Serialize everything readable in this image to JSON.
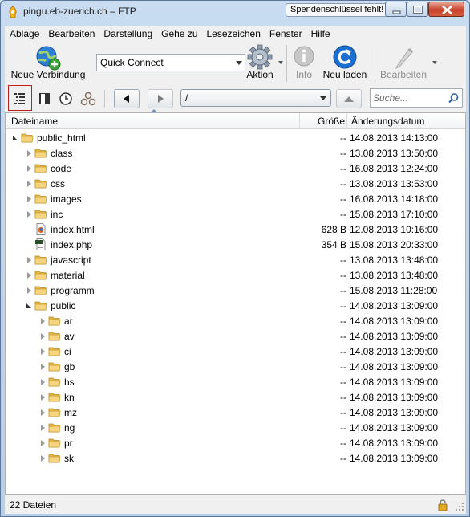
{
  "window": {
    "title": "pingu.eb-zuerich.ch – FTP",
    "donate_badge": "Spendenschlüssel fehlt!"
  },
  "menu": [
    "Ablage",
    "Bearbeiten",
    "Darstellung",
    "Gehe zu",
    "Lesezeichen",
    "Fenster",
    "Hilfe"
  ],
  "toolbar": {
    "new_connection": "Neue Verbindung",
    "quick_connect": "Quick Connect",
    "action": "Aktion",
    "info": "Info",
    "reload": "Neu laden",
    "edit": "Bearbeiten"
  },
  "navigation": {
    "path": "/",
    "search_placeholder": "Suche..."
  },
  "columns": {
    "name": "Dateiname",
    "size": "Größe",
    "date": "Änderungsdatum"
  },
  "files": [
    {
      "name": "public_html",
      "type": "folder",
      "level": 0,
      "expanded": true,
      "size": "--",
      "date": "14.08.2013 14:13:00"
    },
    {
      "name": "class",
      "type": "folder",
      "level": 1,
      "expanded": false,
      "size": "--",
      "date": "13.08.2013 13:50:00"
    },
    {
      "name": "code",
      "type": "folder",
      "level": 1,
      "expanded": false,
      "size": "--",
      "date": "16.08.2013 12:24:00"
    },
    {
      "name": "css",
      "type": "folder",
      "level": 1,
      "expanded": false,
      "size": "--",
      "date": "13.08.2013 13:53:00"
    },
    {
      "name": "images",
      "type": "folder",
      "level": 1,
      "expanded": false,
      "size": "--",
      "date": "16.08.2013 14:18:00"
    },
    {
      "name": "inc",
      "type": "folder",
      "level": 1,
      "expanded": false,
      "size": "--",
      "date": "15.08.2013 17:10:00"
    },
    {
      "name": "index.html",
      "type": "html",
      "level": 1,
      "size": "628 B",
      "date": "12.08.2013 10:16:00"
    },
    {
      "name": "index.php",
      "type": "php",
      "level": 1,
      "size": "354 B",
      "date": "15.08.2013 20:33:00"
    },
    {
      "name": "javascript",
      "type": "folder",
      "level": 1,
      "expanded": false,
      "size": "--",
      "date": "13.08.2013 13:48:00"
    },
    {
      "name": "material",
      "type": "folder",
      "level": 1,
      "expanded": false,
      "size": "--",
      "date": "13.08.2013 13:48:00"
    },
    {
      "name": "programm",
      "type": "folder",
      "level": 1,
      "expanded": false,
      "size": "--",
      "date": "15.08.2013 11:28:00"
    },
    {
      "name": "public",
      "type": "folder",
      "level": 1,
      "expanded": true,
      "size": "--",
      "date": "14.08.2013 13:09:00"
    },
    {
      "name": "ar",
      "type": "folder",
      "level": 2,
      "expanded": false,
      "size": "--",
      "date": "14.08.2013 13:09:00"
    },
    {
      "name": "av",
      "type": "folder",
      "level": 2,
      "expanded": false,
      "size": "--",
      "date": "14.08.2013 13:09:00"
    },
    {
      "name": "ci",
      "type": "folder",
      "level": 2,
      "expanded": false,
      "size": "--",
      "date": "14.08.2013 13:09:00"
    },
    {
      "name": "gb",
      "type": "folder",
      "level": 2,
      "expanded": false,
      "size": "--",
      "date": "14.08.2013 13:09:00"
    },
    {
      "name": "hs",
      "type": "folder",
      "level": 2,
      "expanded": false,
      "size": "--",
      "date": "14.08.2013 13:09:00"
    },
    {
      "name": "kn",
      "type": "folder",
      "level": 2,
      "expanded": false,
      "size": "--",
      "date": "14.08.2013 13:09:00"
    },
    {
      "name": "mz",
      "type": "folder",
      "level": 2,
      "expanded": false,
      "size": "--",
      "date": "14.08.2013 13:09:00"
    },
    {
      "name": "ng",
      "type": "folder",
      "level": 2,
      "expanded": false,
      "size": "--",
      "date": "14.08.2013 13:09:00"
    },
    {
      "name": "pr",
      "type": "folder",
      "level": 2,
      "expanded": false,
      "size": "--",
      "date": "14.08.2013 13:09:00"
    },
    {
      "name": "sk",
      "type": "folder",
      "level": 2,
      "expanded": false,
      "size": "--",
      "date": "14.08.2013 13:09:00"
    }
  ],
  "status": {
    "text": "22 Dateien"
  },
  "colors": {
    "folder": "#e8b84a",
    "accent_blue": "#1b6fd0",
    "active_outline": "#c21d1d"
  }
}
